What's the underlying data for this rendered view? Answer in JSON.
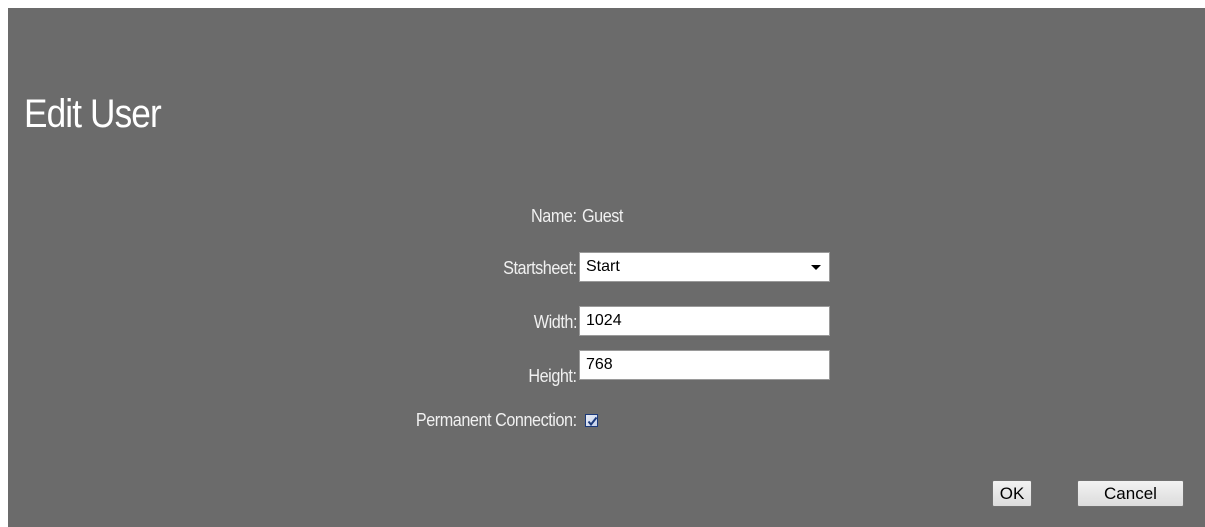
{
  "dialog": {
    "title": "Edit User"
  },
  "form": {
    "name_label": "Name:",
    "name_value": "Guest",
    "startsheet_label": "Startsheet:",
    "startsheet_value": "Start",
    "width_label": "Width:",
    "width_value": "1024",
    "height_label": "Height:",
    "height_value": "768",
    "permanent_label": "Permanent Connection:",
    "permanent_checked": true
  },
  "buttons": {
    "ok_label": "OK",
    "cancel_label": "Cancel"
  },
  "colors": {
    "dialog_background": "#6b6b6b",
    "text": "#f0f0f0",
    "page_background": "#ffffff"
  },
  "icons": {
    "select_arrow": "chevron-down-icon",
    "checkbox_mark": "checkmark-icon"
  }
}
